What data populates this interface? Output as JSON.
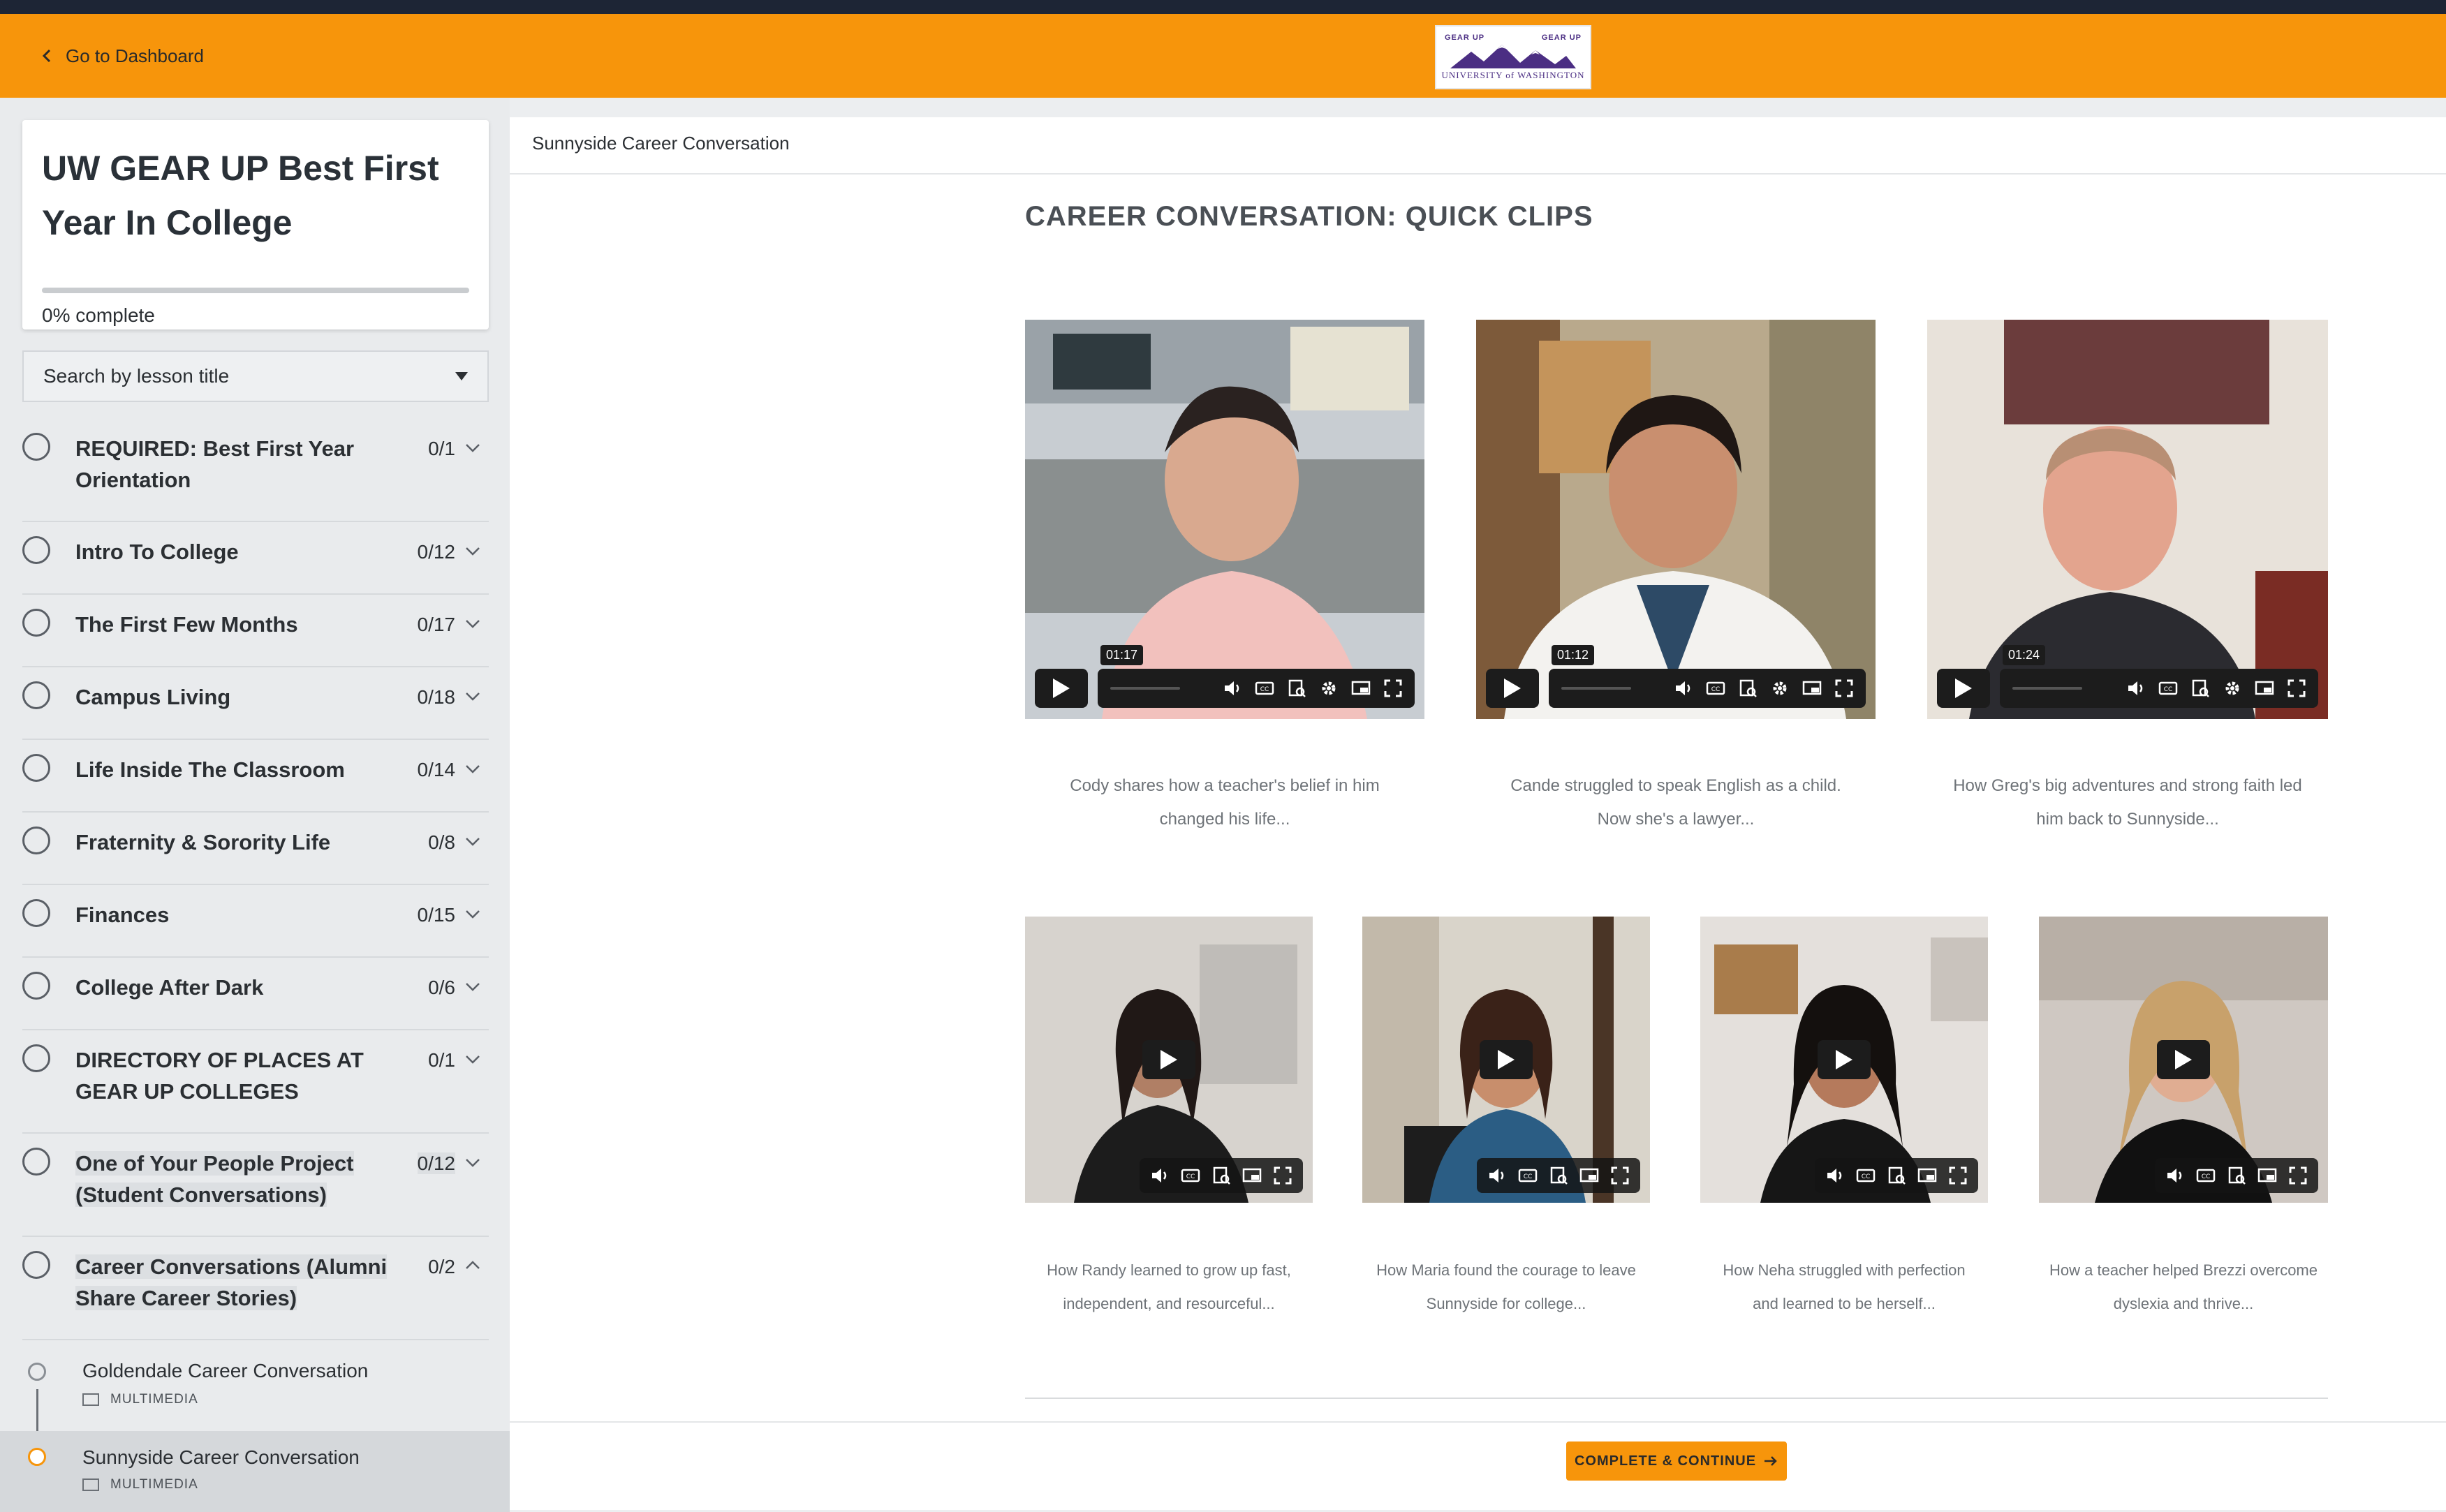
{
  "header": {
    "back_label": "Go to Dashboard",
    "logo": {
      "top_left": "GEAR UP",
      "top_right": "GEAR UP",
      "bottom": "UNIVERSITY of WASHINGTON"
    },
    "brand_color": "#f7950b"
  },
  "sidebar": {
    "course_title": "UW GEAR UP Best First Year In College",
    "progress_value": 0,
    "progress_label": "0% complete",
    "search_placeholder": "Search by lesson title",
    "lessons": [
      {
        "title": "REQUIRED: Best First Year Orientation",
        "count": "0/1",
        "expanded": false
      },
      {
        "title": "Intro To College",
        "count": "0/12",
        "expanded": false
      },
      {
        "title": "The First Few Months",
        "count": "0/17",
        "expanded": false
      },
      {
        "title": "Campus Living",
        "count": "0/18",
        "expanded": false
      },
      {
        "title": "Life Inside The Classroom",
        "count": "0/14",
        "expanded": false
      },
      {
        "title": "Fraternity & Sorority Life",
        "count": "0/8",
        "expanded": false
      },
      {
        "title": "Finances",
        "count": "0/15",
        "expanded": false
      },
      {
        "title": "College After Dark",
        "count": "0/6",
        "expanded": false
      },
      {
        "title": "DIRECTORY OF PLACES AT GEAR UP COLLEGES",
        "count": "0/1",
        "expanded": false
      },
      {
        "title": "One of Your People Project (Student Conversations)",
        "count": "0/12",
        "expanded": false
      },
      {
        "title": "Career Conversations (Alumni Share Career Stories)",
        "count": "0/2",
        "expanded": true
      }
    ],
    "sublessons": [
      {
        "title": "Goldendale Career Conversation",
        "type": "MULTIMEDIA",
        "active": false
      },
      {
        "title": "Sunnyside Career Conversation",
        "type": "MULTIMEDIA",
        "active": true
      }
    ]
  },
  "main": {
    "breadcrumb": "Sunnyside Career Conversation",
    "section_title": "CAREER CONVERSATION: QUICK CLIPS",
    "videos_top": [
      {
        "time": "01:17",
        "caption_l1": "Cody shares how a teacher's belief in him",
        "caption_l2": "changed his life..."
      },
      {
        "time": "01:12",
        "caption_l1": "Cande struggled to speak English as a child.",
        "caption_l2": "Now she's a lawyer..."
      },
      {
        "time": "01:24",
        "caption_l1": "How Greg's big adventures and strong faith led",
        "caption_l2": "him back to Sunnyside..."
      }
    ],
    "videos_bottom": [
      {
        "caption_l1": "How Randy learned to grow up fast,",
        "caption_l2": "independent, and resourceful..."
      },
      {
        "caption_l1": "How Maria found the courage to leave",
        "caption_l2": "Sunnyside for college..."
      },
      {
        "caption_l1": "How Neha struggled with perfection",
        "caption_l2": "and learned to be herself..."
      },
      {
        "caption_l1": "How a teacher helped Brezzi overcome",
        "caption_l2": "dyslexia and thrive..."
      }
    ],
    "complete_button": "COMPLETE & CONTINUE"
  }
}
